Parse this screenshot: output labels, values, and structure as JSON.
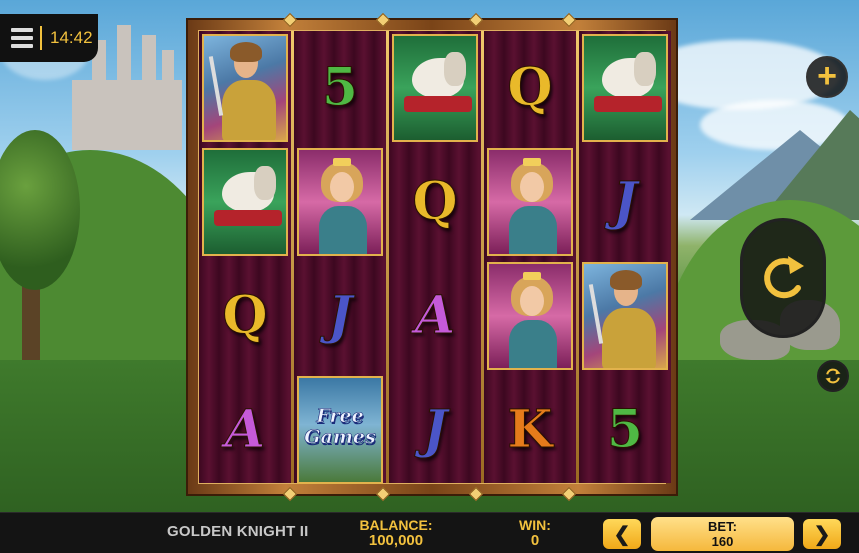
{
  "status": {
    "clock": "14:42"
  },
  "reels": [
    [
      {
        "type": "picture",
        "symbol": "knight"
      },
      {
        "type": "picture",
        "symbol": "horse"
      },
      {
        "type": "letter",
        "symbol": "Q"
      },
      {
        "type": "letter",
        "symbol": "A"
      }
    ],
    [
      {
        "type": "letter",
        "symbol": "5"
      },
      {
        "type": "picture",
        "symbol": "lady"
      },
      {
        "type": "letter",
        "symbol": "J"
      },
      {
        "type": "scatter",
        "symbol": "free-games",
        "label_line1": "Free",
        "label_line2": "Games"
      }
    ],
    [
      {
        "type": "picture",
        "symbol": "horse"
      },
      {
        "type": "letter",
        "symbol": "Q"
      },
      {
        "type": "letter",
        "symbol": "A"
      },
      {
        "type": "letter",
        "symbol": "J"
      }
    ],
    [
      {
        "type": "letter",
        "symbol": "Q"
      },
      {
        "type": "picture",
        "symbol": "lady"
      },
      {
        "type": "picture",
        "symbol": "lady"
      },
      {
        "type": "letter",
        "symbol": "K"
      }
    ],
    [
      {
        "type": "picture",
        "symbol": "horse"
      },
      {
        "type": "letter",
        "symbol": "J"
      },
      {
        "type": "picture",
        "symbol": "knight"
      },
      {
        "type": "letter",
        "symbol": "5"
      }
    ]
  ],
  "controls": {
    "plus_label": "+",
    "prev_label": "❮",
    "next_label": "❯"
  },
  "footer": {
    "game_title": "GOLDEN KNIGHT II",
    "balance_label": "BALANCE:",
    "balance_value": "100,000",
    "win_label": "WIN:",
    "win_value": "0",
    "bet_label": "BET:",
    "bet_value": "160"
  },
  "colors": {
    "accent_gold": "#f2c13e",
    "bar_background": "#141414",
    "reel_background": "#3d0820"
  }
}
